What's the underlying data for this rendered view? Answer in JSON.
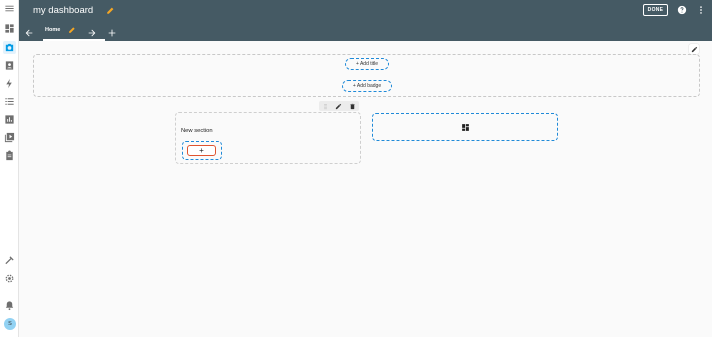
{
  "header": {
    "title": "my dashboard",
    "done_label": "DONE"
  },
  "tabs": [
    {
      "label": "Home"
    }
  ],
  "main": {
    "add_title_label": "+ Add title",
    "add_badge_label": "+ Add badge",
    "section": {
      "title": "New section",
      "add_card_label": "+"
    }
  },
  "user": {
    "avatar_initial": "S"
  },
  "colors": {
    "header_bg": "#455a64",
    "accent_blue": "#1f8ad8",
    "highlight_orange": "#e0542f",
    "pencil_orange": "#f5a623",
    "sidebar_active": "#039be5"
  },
  "icons": {
    "sidebar": [
      "menu-icon",
      "dashboard-icon",
      "camera-icon",
      "account-box-icon",
      "lightning-icon",
      "list-icon",
      "chart-icon",
      "media-icon",
      "clipboard-icon",
      "hammer-icon",
      "gear-icon",
      "bell-icon"
    ]
  }
}
